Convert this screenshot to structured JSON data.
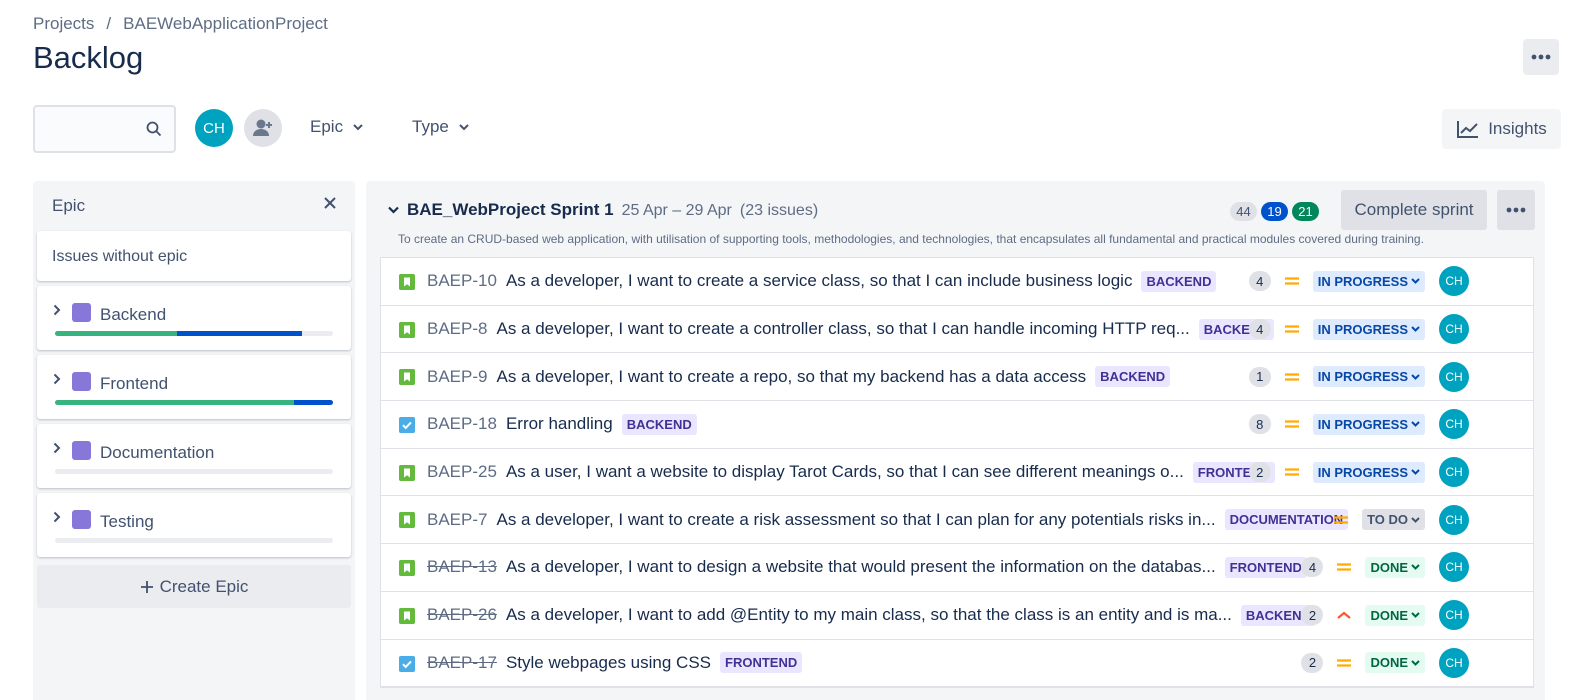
{
  "breadcrumb": {
    "projects": "Projects",
    "separator": "/",
    "project": "BAEWebApplicationProject"
  },
  "page": {
    "title": "Backlog"
  },
  "toolbar": {
    "search_placeholder": "",
    "avatar_initials": "CH",
    "epic_filter": "Epic",
    "type_filter": "Type",
    "insights": "Insights"
  },
  "epics": {
    "header": "Epic",
    "no_epic": "Issues without epic",
    "create": "Create Epic",
    "items": [
      {
        "name": "Backend",
        "done": 0.44,
        "in_progress": 0.45
      },
      {
        "name": "Frontend",
        "done": 0.86,
        "in_progress": 0.14
      },
      {
        "name": "Documentation",
        "done": 0,
        "in_progress": 0
      },
      {
        "name": "Testing",
        "done": 0,
        "in_progress": 0
      }
    ]
  },
  "sprint": {
    "name": "BAE_WebProject Sprint 1",
    "dates": "25 Apr – 29 Apr",
    "issue_count": "(23 issues)",
    "goal": "To create an CRUD-based web application, with utilisation of supporting tools, methodologies, and technologies, that encapsulates all fundamental and practical modules covered during training.",
    "counts": {
      "todo": "44",
      "in_progress": "19",
      "done": "21"
    },
    "complete_button": "Complete sprint"
  },
  "issues": [
    {
      "key": "BAEP-10",
      "summary": "As a developer, I want to create a service class, so that I can include business logic",
      "epic": "BACKEND",
      "points": "4",
      "status": "IN PROGRESS",
      "assignee": "CH",
      "type": "story"
    },
    {
      "key": "BAEP-8",
      "summary": "As a developer, I want to create a controller class, so that I can handle incoming HTTP req...",
      "epic": "BACKEND",
      "points": "4",
      "status": "IN PROGRESS",
      "assignee": "CH",
      "type": "story"
    },
    {
      "key": "BAEP-9",
      "summary": "As a developer, I want to create a repo, so that my backend has a data access",
      "epic": "BACKEND",
      "points": "1",
      "status": "IN PROGRESS",
      "assignee": "CH",
      "type": "story"
    },
    {
      "key": "BAEP-18",
      "summary": "Error handling",
      "epic": "BACKEND",
      "points": "8",
      "status": "IN PROGRESS",
      "assignee": "CH",
      "type": "task"
    },
    {
      "key": "BAEP-25",
      "summary": "As a user, I want a website to display Tarot Cards, so that I can see different meanings o...",
      "epic": "FRONTEND",
      "points": "2",
      "status": "IN PROGRESS",
      "assignee": "CH",
      "type": "story"
    },
    {
      "key": "BAEP-7",
      "summary": "As a developer, I want to create a risk assessment so that I can plan for any potentials risks in...",
      "epic": "DOCUMENTATION",
      "points": "",
      "status": "TO DO",
      "assignee": "CH",
      "type": "story"
    },
    {
      "key": "BAEP-13",
      "summary": "As a developer, I want to design a website that would present the information on the databas...",
      "epic": "FRONTEND",
      "points": "4",
      "status": "DONE",
      "assignee": "CH",
      "type": "story"
    },
    {
      "key": "BAEP-26",
      "summary": "As a developer, I want to add @Entity to my main class, so that the class is an entity and is ma...",
      "epic": "BACKEND",
      "points": "2",
      "status": "DONE",
      "assignee": "CH",
      "type": "story",
      "priority": "high"
    },
    {
      "key": "BAEP-17",
      "summary": "Style webpages using CSS",
      "epic": "FRONTEND",
      "points": "2",
      "status": "DONE",
      "assignee": "CH",
      "type": "task"
    }
  ],
  "colors": {
    "avatar": "#00a3bf",
    "epic": "#8777d9",
    "priority_medium": "#ffab00",
    "priority_high": "#ff5630"
  }
}
